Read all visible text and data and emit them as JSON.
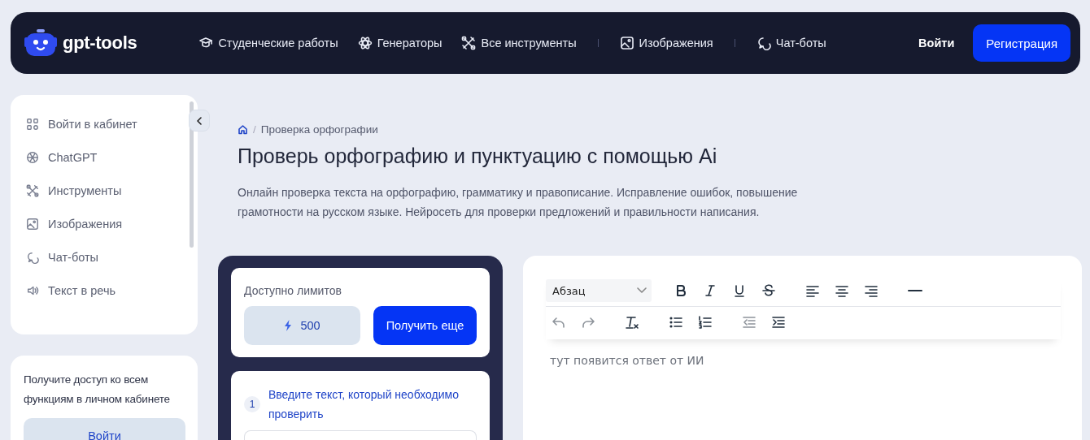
{
  "header": {
    "logo": "gpt-tools",
    "nav_groups": [
      [
        {
          "label": "Студенческие работы"
        },
        {
          "label": "Генераторы"
        },
        {
          "label": "Все инструменты"
        }
      ],
      [
        {
          "label": "Изображения"
        }
      ],
      [
        {
          "label": "Чат-боты"
        }
      ]
    ],
    "login": "Войти",
    "register": "Регистрация"
  },
  "sidebar": {
    "items": [
      {
        "label": "Войти в кабинет"
      },
      {
        "label": "ChatGPT"
      },
      {
        "label": "Инструменты"
      },
      {
        "label": "Изображения"
      },
      {
        "label": "Чат-боты"
      },
      {
        "label": "Текст в речь"
      }
    ]
  },
  "promo": {
    "text": "Получите доступ ко всем функциям в личном кабинете",
    "button": "Войти"
  },
  "breadcrumb": {
    "separator": "/",
    "current": "Проверка орфографии"
  },
  "title": "Проверь орфографию и пунктуацию с помощью Ai",
  "description": "Онлайн проверка текста на орфографию, грамматику и правописание. Исправление ошибок, повышение грамотности на русском языке. Нейросеть для проверки предложений и правильности написания.",
  "limits": {
    "label": "Доступно лимитов",
    "count": "500",
    "button": "Получить еще"
  },
  "step": {
    "number": "1",
    "text": "Введите текст, который необходимо проверить"
  },
  "editor": {
    "format": "Абзац",
    "rows": [
      {
        "groups": [
          [
            {
              "kind": "bold",
              "disabled": false
            },
            {
              "kind": "italic",
              "disabled": false
            },
            {
              "kind": "underline",
              "disabled": false
            },
            {
              "kind": "strike",
              "disabled": false
            }
          ],
          [
            {
              "kind": "align-left",
              "disabled": false
            },
            {
              "kind": "align-center",
              "disabled": false
            },
            {
              "kind": "align-right",
              "disabled": false
            }
          ],
          [
            {
              "kind": "rule",
              "disabled": false
            }
          ]
        ]
      },
      {
        "groups": [
          [
            {
              "kind": "undo",
              "disabled": true
            },
            {
              "kind": "redo",
              "disabled": true
            }
          ],
          [
            {
              "kind": "clear-format",
              "disabled": false
            }
          ],
          [
            {
              "kind": "bullet-list",
              "disabled": false
            },
            {
              "kind": "numbered-list",
              "disabled": false
            }
          ],
          [
            {
              "kind": "outdent",
              "disabled": true
            },
            {
              "kind": "indent",
              "disabled": false
            }
          ]
        ]
      }
    ],
    "placeholder": "тут появится ответ от ИИ"
  }
}
